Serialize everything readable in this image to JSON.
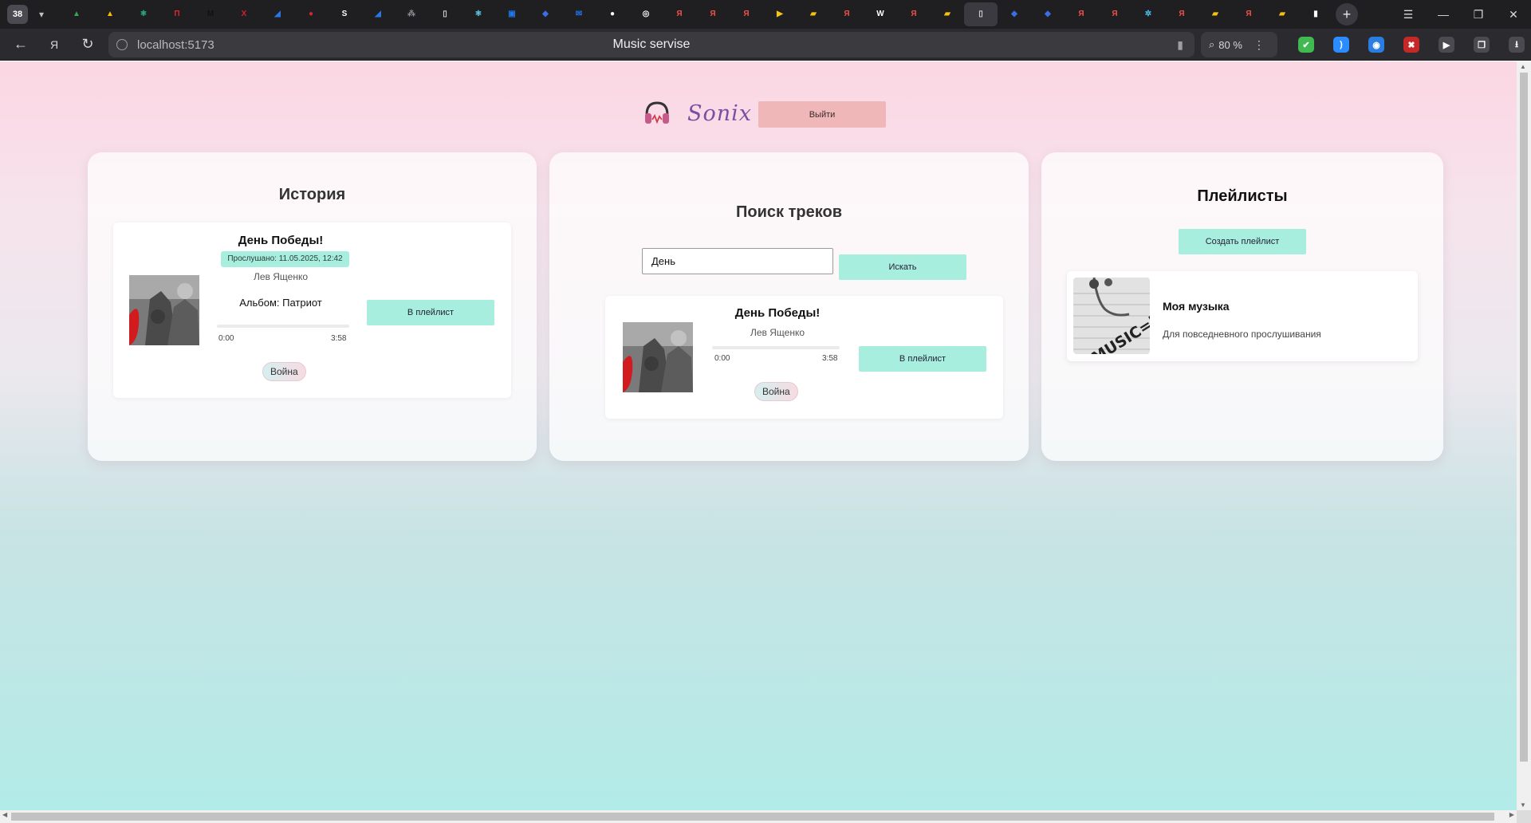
{
  "browser": {
    "tab_count": "38",
    "url": "localhost:5173",
    "page_title": "Music servise",
    "zoom": "80 %",
    "tabs": [
      {
        "icon": "google-drive-icon",
        "color": "#34a853",
        "glyph": "▲"
      },
      {
        "icon": "google-drive-icon",
        "color": "#fbbc04",
        "glyph": "▲"
      },
      {
        "icon": "atom-icon",
        "color": "#2fbf8f",
        "glyph": "⚛"
      },
      {
        "icon": "red-square-icon",
        "color": "#e3262e",
        "glyph": "П"
      },
      {
        "icon": "medium-icon",
        "color": "#111111",
        "glyph": "M"
      },
      {
        "icon": "red-x-icon",
        "color": "#d01f2c",
        "glyph": "X"
      },
      {
        "icon": "wing-icon",
        "color": "#2b76e6",
        "glyph": "◢"
      },
      {
        "icon": "record-icon",
        "color": "#d6262c",
        "glyph": "●"
      },
      {
        "icon": "s-circle-icon",
        "color": "#ffffff",
        "glyph": "S"
      },
      {
        "icon": "wing-icon",
        "color": "#2b76e6",
        "glyph": "◢"
      },
      {
        "icon": "network-icon",
        "color": "#8b8b90",
        "glyph": "⁂"
      },
      {
        "icon": "document-icon",
        "color": "#d8d8dc",
        "glyph": "▯"
      },
      {
        "icon": "react-icon",
        "color": "#61dafb",
        "glyph": "⚛"
      },
      {
        "icon": "chat-icon",
        "color": "#1d78e8",
        "glyph": "▣"
      },
      {
        "icon": "bird-icon",
        "color": "#3a6ee8",
        "glyph": "◆"
      },
      {
        "icon": "mail-icon",
        "color": "#1e74f0",
        "glyph": "✉"
      },
      {
        "icon": "github-icon",
        "color": "#ffffff",
        "glyph": "●"
      },
      {
        "icon": "openai-icon",
        "color": "#ffffff",
        "glyph": "◎"
      },
      {
        "icon": "yandex-icon",
        "color": "#f0504a",
        "glyph": "Я"
      },
      {
        "icon": "yandex-icon",
        "color": "#f0504a",
        "glyph": "Я"
      },
      {
        "icon": "yandex-icon",
        "color": "#f0504a",
        "glyph": "Я"
      },
      {
        "icon": "play-icon",
        "color": "#f5c518",
        "glyph": "▶"
      },
      {
        "icon": "yellow-folder-icon",
        "color": "#f4c20d",
        "glyph": "▰"
      },
      {
        "icon": "yandex-icon",
        "color": "#f0504a",
        "glyph": "Я"
      },
      {
        "icon": "wikipedia-icon",
        "color": "#ffffff",
        "glyph": "W"
      },
      {
        "icon": "yandex-icon",
        "color": "#f0504a",
        "glyph": "Я"
      },
      {
        "icon": "yellow-folder-icon",
        "color": "#f4c20d",
        "glyph": "▰"
      },
      {
        "icon": "document-icon",
        "color": "#d8d8dc",
        "glyph": "▯"
      },
      {
        "icon": "bird-icon",
        "color": "#3a6ee8",
        "glyph": "◆"
      },
      {
        "icon": "bird-icon",
        "color": "#3a6ee8",
        "glyph": "◆"
      },
      {
        "icon": "yandex-icon",
        "color": "#f0504a",
        "glyph": "Я"
      },
      {
        "icon": "yandex-icon",
        "color": "#f0504a",
        "glyph": "Я"
      },
      {
        "icon": "snowflake-icon",
        "color": "#4fc3f7",
        "glyph": "✲"
      },
      {
        "icon": "yandex-icon",
        "color": "#f0504a",
        "glyph": "Я"
      },
      {
        "icon": "yellow-folder-icon",
        "color": "#f4c20d",
        "glyph": "▰"
      },
      {
        "icon": "yandex-icon",
        "color": "#f0504a",
        "glyph": "Я"
      },
      {
        "icon": "yellow-folder-icon",
        "color": "#f4c20d",
        "glyph": "▰"
      },
      {
        "icon": "bookmark-page-icon",
        "color": "#ffffff",
        "glyph": "▮"
      }
    ],
    "extensions": [
      {
        "icon": "shield-check-icon",
        "color": "#3fb950",
        "glyph": "✔"
      },
      {
        "icon": "alice-voice-icon",
        "color": "#2b8cff",
        "glyph": ")"
      },
      {
        "icon": "mask-icon",
        "color": "#2a7de1",
        "glyph": "◉"
      },
      {
        "icon": "ublock-icon",
        "color": "#c62828",
        "glyph": "✖"
      },
      {
        "icon": "media-play-icon",
        "color": "#4a4a50",
        "glyph": "▶"
      },
      {
        "icon": "collections-icon",
        "color": "#4a4a50",
        "glyph": "❐"
      },
      {
        "icon": "download-icon",
        "color": "#4a4a50",
        "glyph": "⭳"
      }
    ]
  },
  "app": {
    "brand": "Sonix",
    "logout_label": "Выйти",
    "accent_color": "#a8eedf",
    "logout_color": "#f0b7b9"
  },
  "history": {
    "title": "История",
    "track": {
      "title": "День Победы!",
      "listened_at": "Прослушано: 11.05.2025, 12:42",
      "artist": "Лев Ященко",
      "album": "Альбом: Патриот",
      "time_start": "0:00",
      "time_end": "3:58",
      "progress": 0,
      "to_playlist_label": "В плейлист",
      "genre": "Война"
    }
  },
  "search": {
    "title": "Поиск треков",
    "query": "День",
    "button_label": "Искать",
    "result": {
      "title": "День Победы!",
      "artist": "Лев Ященко",
      "time_start": "0:00",
      "time_end": "3:58",
      "progress": 0,
      "to_playlist_label": "В плейлист",
      "genre": "Война"
    }
  },
  "playlists": {
    "title": "Плейлисты",
    "create_label": "Создать плейлист",
    "items": [
      {
        "name": "Моя музыка",
        "description": "Для повседневного прослушивания",
        "cover_text": "MUSIC=life"
      }
    ]
  }
}
